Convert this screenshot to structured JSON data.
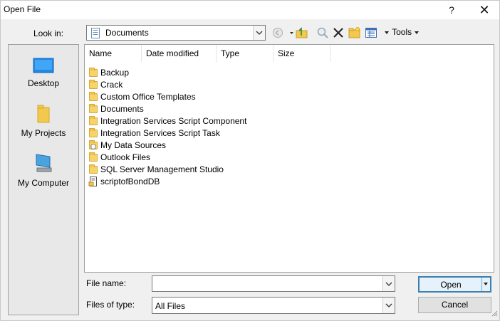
{
  "window": {
    "title": "Open File",
    "help": "?",
    "close": "✕"
  },
  "lookin": {
    "label": "Look in:",
    "value": "Documents"
  },
  "toolbar": {
    "tools_label": "Tools"
  },
  "places": [
    {
      "label": "Desktop"
    },
    {
      "label": "My Projects"
    },
    {
      "label": "My Computer"
    }
  ],
  "columns": [
    "Name",
    "Date modified",
    "Type",
    "Size"
  ],
  "files": [
    {
      "name": "Backup",
      "kind": "folder"
    },
    {
      "name": "Crack",
      "kind": "folder"
    },
    {
      "name": "Custom Office Templates",
      "kind": "folder"
    },
    {
      "name": "Documents",
      "kind": "folder"
    },
    {
      "name": "Integration Services Script Component",
      "kind": "folder"
    },
    {
      "name": "Integration Services Script Task",
      "kind": "folder"
    },
    {
      "name": "My Data Sources",
      "kind": "datasource"
    },
    {
      "name": "Outlook Files",
      "kind": "folder"
    },
    {
      "name": "SQL Server Management Studio",
      "kind": "folder"
    },
    {
      "name": "scriptofBondDB",
      "kind": "file"
    }
  ],
  "filename": {
    "label": "File name:",
    "value": ""
  },
  "filetype": {
    "label": "Files of type:",
    "value": "All Files"
  },
  "buttons": {
    "open": "Open",
    "cancel": "Cancel"
  },
  "colors": {
    "accent": "#3c7fb1",
    "folder": "#f7d36a",
    "panel_bg": "#f0f0f0"
  }
}
